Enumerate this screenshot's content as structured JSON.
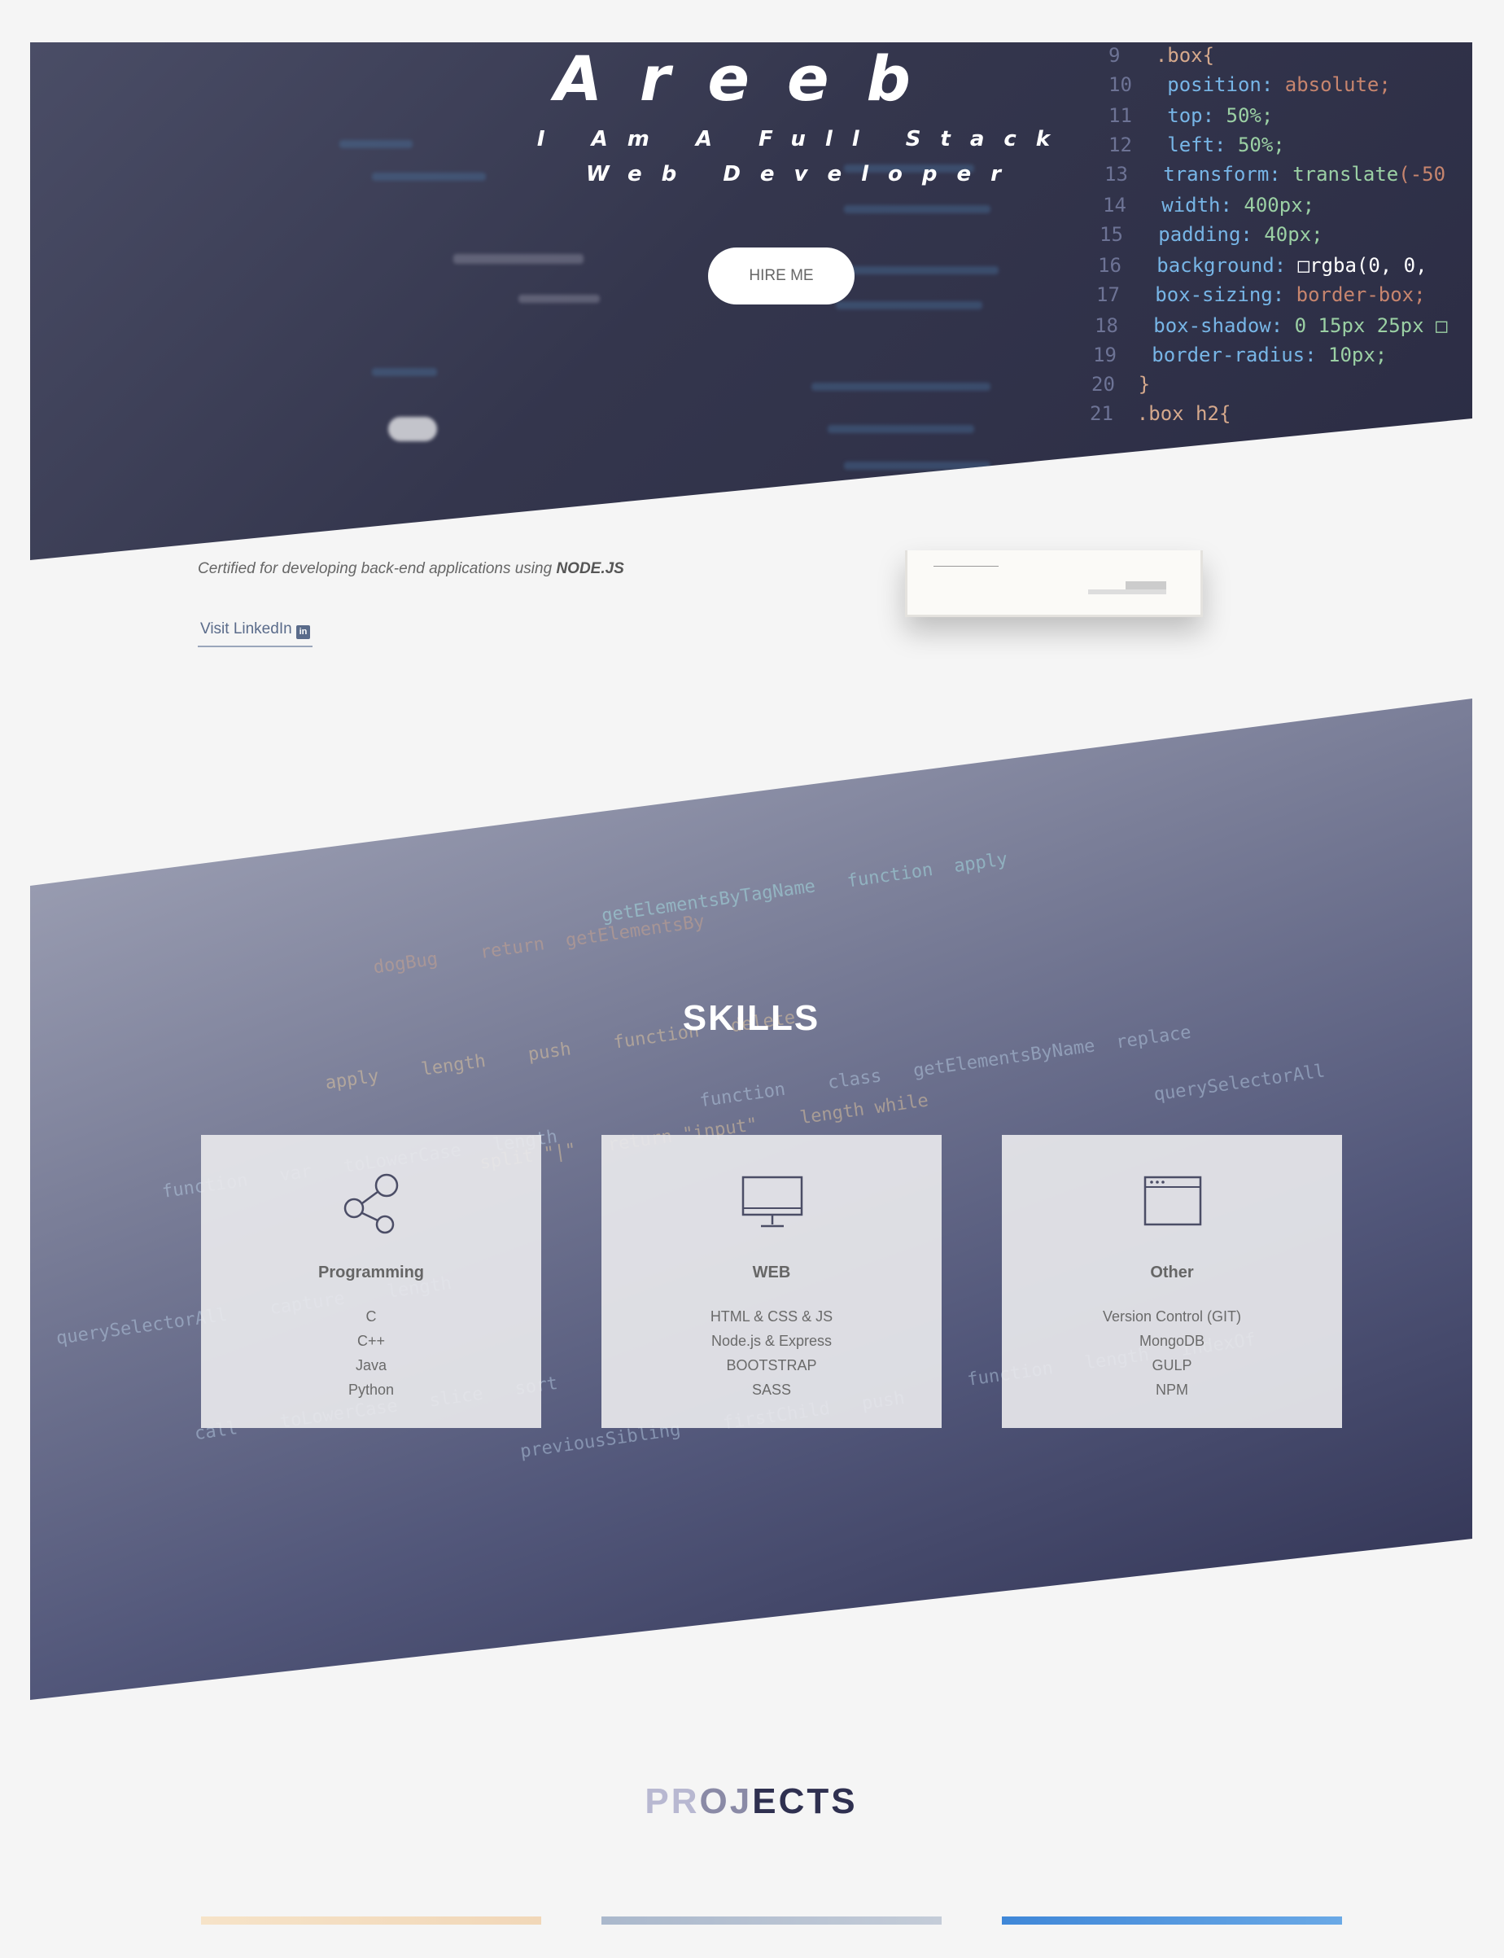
{
  "hero": {
    "name": "Areeb",
    "subtitle": "I Am A Full Stack Web Developer",
    "hire_button": "HIRE ME"
  },
  "certification": {
    "text_prefix": "Certified for developing back-end applications using ",
    "text_highlight": "NODE.JS",
    "linkedin_link": "Visit LinkedIn",
    "linkedin_icon": "linkedin-icon"
  },
  "skills": {
    "title": "SKILLS",
    "cards": [
      {
        "title": "Programming",
        "icon": "share-nodes-icon",
        "items": [
          "C",
          "C++",
          "Java",
          "Python"
        ]
      },
      {
        "title": "WEB",
        "icon": "monitor-icon",
        "items": [
          "HTML & CSS & JS",
          "Node.js & Express",
          "BOOTSTRAP",
          "SASS"
        ]
      },
      {
        "title": "Other",
        "icon": "browser-window-icon",
        "items": [
          "Version Control (GIT)",
          "MongoDB",
          "GULP",
          "NPM"
        ]
      }
    ]
  },
  "projects": {
    "title_part1": "PR",
    "title_part2": "OJ",
    "title_part3": "ECTS"
  },
  "colors": {
    "hero_bg": "#34364d",
    "accent_dark": "#2f3050",
    "link": "#5a6b8a"
  }
}
